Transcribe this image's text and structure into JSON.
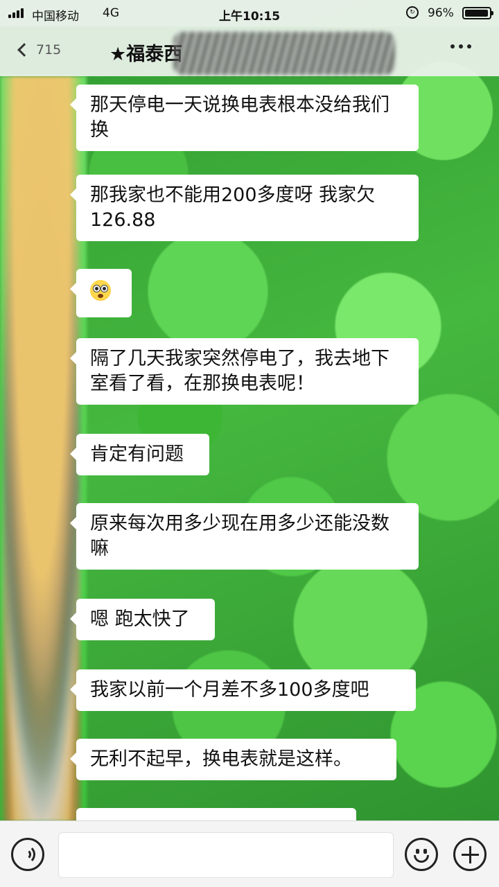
{
  "status_bar": {
    "carrier": "中国移动",
    "network": "4G",
    "time": "上午10:15",
    "battery_percent": "96%",
    "battery_level": 0.96
  },
  "nav": {
    "back_icon": "chevron-left-icon",
    "unread_count": "715",
    "title": "★福泰西",
    "more_icon": "more-dots-icon"
  },
  "messages": [
    {
      "text": "那天停电一天说换电表根本没给我们换"
    },
    {
      "text": "那我家也不能用200多度呀 我家欠126.88"
    },
    {
      "emoji": "flushed-face"
    },
    {
      "text": "隔了几天我家突然停电了，我去地下室看了看，在那换电表呢！"
    },
    {
      "text": "肯定有问题"
    },
    {
      "text": "原来每次用多少现在用多少还能没数嘛"
    },
    {
      "text": "嗯 跑太快了"
    },
    {
      "text": "我家以前一个月差不多100多度吧"
    },
    {
      "text": "无利不起早，换电表就是这样。"
    },
    {
      "text": ""
    }
  ],
  "input_bar": {
    "voice_icon": "voice-icon",
    "input_value": "",
    "emoji_icon": "emoji-icon",
    "plus_icon": "plus-icon"
  },
  "colors": {
    "bubble": "#ffffff",
    "bar": "#f4f4f4",
    "background": "#3aa83a"
  }
}
